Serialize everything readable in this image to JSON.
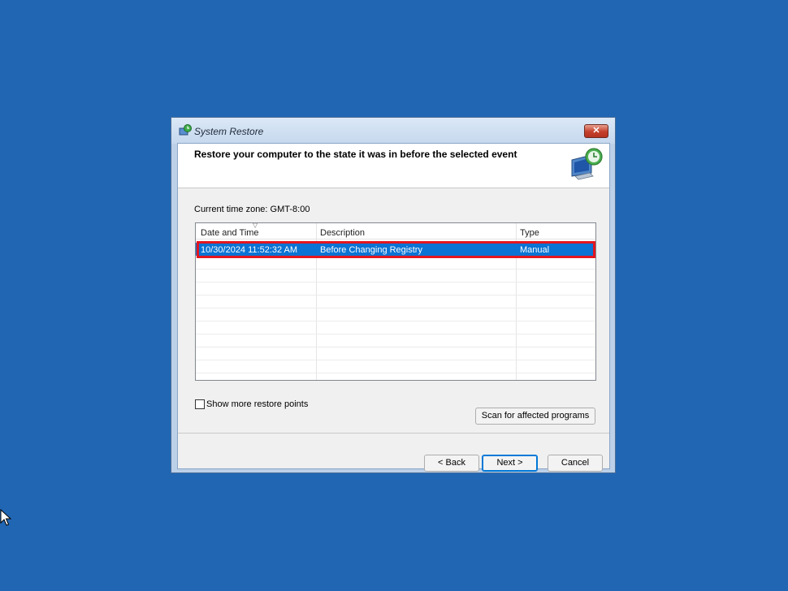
{
  "window": {
    "title": "System Restore",
    "close_label": "✕",
    "header_text": "Restore your computer to the state it was in before the selected event"
  },
  "timezone_label": "Current time zone: GMT-8:00",
  "table": {
    "columns": [
      "Date and Time",
      "Description",
      "Type"
    ],
    "rows": [
      [
        "10/30/2024 11:52:32 AM",
        "Before Changing Registry",
        "Manual"
      ]
    ]
  },
  "show_more_label": "Show more restore points",
  "show_more_checked": false,
  "buttons": {
    "scan": "Scan for affected programs",
    "back": "< Back",
    "next": "Next >",
    "cancel": "Cancel"
  },
  "colors": {
    "desktop": "#2166b3",
    "selection": "#0a73d4",
    "highlight_box": "#e3171f"
  },
  "icons": {
    "title": "system-restore-icon",
    "header": "computer-restore-icon"
  }
}
